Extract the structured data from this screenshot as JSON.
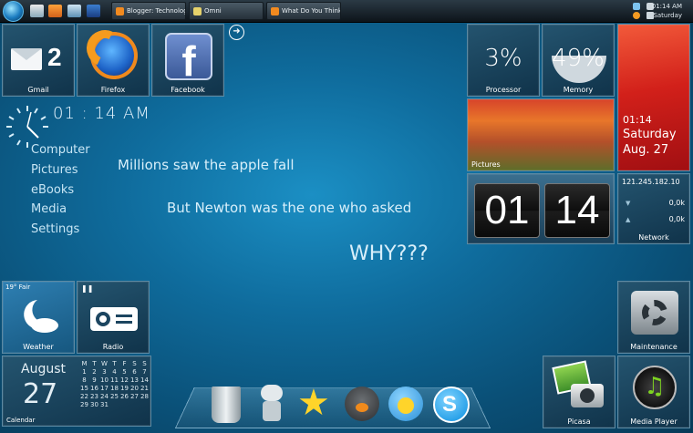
{
  "taskbar": {
    "tasks": [
      "Blogger: Technolog...",
      "Omni",
      "What Do You Think ..."
    ],
    "time": "01:14 AM",
    "day": "Saturday"
  },
  "tiles": {
    "gmail": {
      "label": "Gmail",
      "count": "2"
    },
    "firefox": {
      "label": "Firefox"
    },
    "facebook": {
      "label": "Facebook",
      "glyph": "f"
    },
    "processor": {
      "label": "Processor",
      "value": "3%"
    },
    "memory": {
      "label": "Memory",
      "value": "49%"
    },
    "date": {
      "time": "01:14",
      "day": "Saturday",
      "date": "Aug. 27"
    },
    "pictures": {
      "label": "Pictures"
    },
    "flip_clock": {
      "hours": "01",
      "minutes": "14"
    },
    "network": {
      "label": "Network",
      "ip": "121.245.182.10",
      "down": "0,0k",
      "up": "0,0k"
    },
    "weather": {
      "label": "Weather",
      "temp": "19° Fair"
    },
    "radio": {
      "label": "Radio"
    },
    "calendar": {
      "label": "Calendar",
      "month": "August",
      "day": "27",
      "weekdays": [
        "M",
        "T",
        "W",
        "T",
        "F",
        "S",
        "S"
      ],
      "rows": [
        [
          "1",
          "2",
          "3",
          "4",
          "5",
          "6",
          "7"
        ],
        [
          "8",
          "9",
          "10",
          "11",
          "12",
          "13",
          "14"
        ],
        [
          "15",
          "16",
          "17",
          "18",
          "19",
          "20",
          "21"
        ],
        [
          "22",
          "23",
          "24",
          "25",
          "26",
          "27",
          "28"
        ],
        [
          "29",
          "30",
          "31",
          "",
          "",
          "",
          ""
        ]
      ]
    },
    "maintenance": {
      "label": "Maintenance"
    },
    "picasa": {
      "label": "Picasa"
    },
    "media_player": {
      "label": "Media Player"
    }
  },
  "clock": {
    "time": "01 : 14 AM"
  },
  "menu": [
    "Computer",
    "Pictures",
    "eBooks",
    "Media",
    "Settings"
  ],
  "quote": {
    "line1": "Millions saw the apple fall",
    "line2": "But Newton was the one who asked",
    "line3": "WHY???"
  },
  "colors": {
    "background": "#0f6c9d",
    "accent": "#d2201a",
    "tile": "#16405a"
  },
  "dock_icons": [
    "recycle-bin-icon",
    "robot-icon",
    "star-icon",
    "bird-icon",
    "messenger-icon",
    "skype-icon"
  ]
}
